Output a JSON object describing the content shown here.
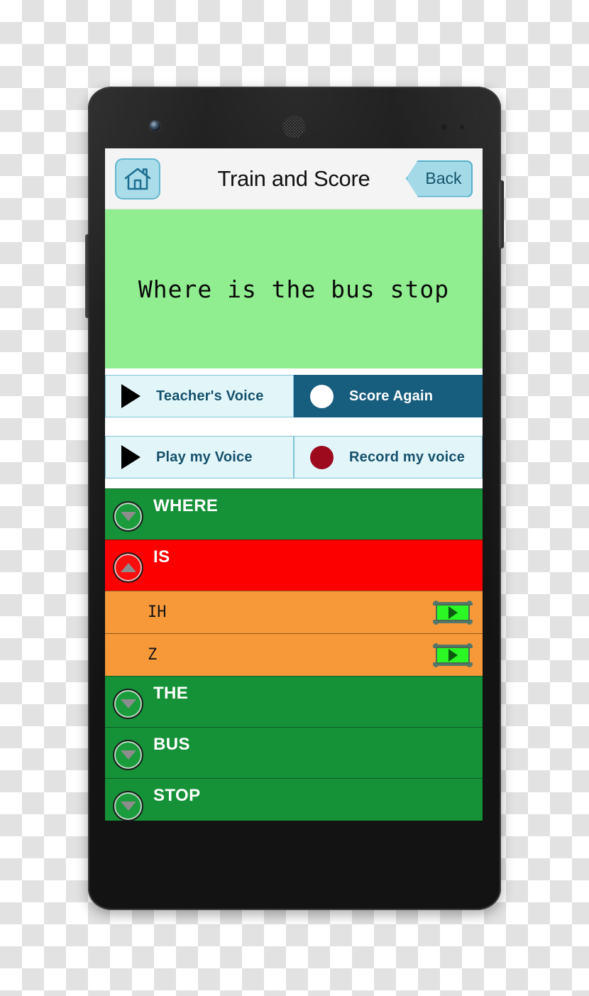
{
  "app": {
    "header": {
      "title": "Train and Score",
      "home_icon": "home-icon",
      "back_label": "Back"
    },
    "sentence": {
      "text": "Where is the bus stop",
      "background_color": "#90ee90"
    },
    "controls": [
      {
        "id": "teachers-voice",
        "label": "Teacher's Voice",
        "icon": "play-icon",
        "style": "light"
      },
      {
        "id": "score-again",
        "label": "Score Again",
        "icon": "white-circle-icon",
        "style": "dark"
      },
      {
        "id": "play-my-voice",
        "label": "Play my Voice",
        "icon": "play-icon",
        "style": "light"
      },
      {
        "id": "record-my-voice",
        "label": "Record my voice",
        "icon": "record-circle-icon",
        "style": "light"
      }
    ],
    "words": [
      {
        "label": "WHERE",
        "status": "green",
        "expanded": false,
        "toggle_icon": "chevron-down-icon",
        "color": "#159137"
      },
      {
        "label": "IS",
        "status": "red",
        "expanded": true,
        "toggle_icon": "chevron-up-icon",
        "color": "#fc0000"
      },
      {
        "label": "THE",
        "status": "green",
        "expanded": false,
        "toggle_icon": "chevron-down-icon",
        "color": "#159137"
      },
      {
        "label": "BUS",
        "status": "green",
        "expanded": false,
        "toggle_icon": "chevron-down-icon",
        "color": "#159137"
      },
      {
        "label": "STOP",
        "status": "green",
        "expanded": false,
        "toggle_icon": "chevron-down-icon",
        "color": "#159137"
      }
    ],
    "phonemes": [
      {
        "label": "IH",
        "video_icon": "video-play-icon",
        "color": "#f79939"
      },
      {
        "label": "Z",
        "video_icon": "video-play-icon",
        "color": "#f79939"
      }
    ],
    "colors": {
      "accent_light": "#aadcea",
      "accent_dark": "#175d7e",
      "correct": "#159137",
      "incorrect": "#fc0000",
      "phoneme": "#f79939",
      "sentence_bg": "#90ee90"
    }
  },
  "device": {
    "camera_icon": "front-camera-icon",
    "speaker_icon": "earpiece-speaker-icon",
    "power_button": "power-button",
    "volume_button": "volume-button"
  }
}
